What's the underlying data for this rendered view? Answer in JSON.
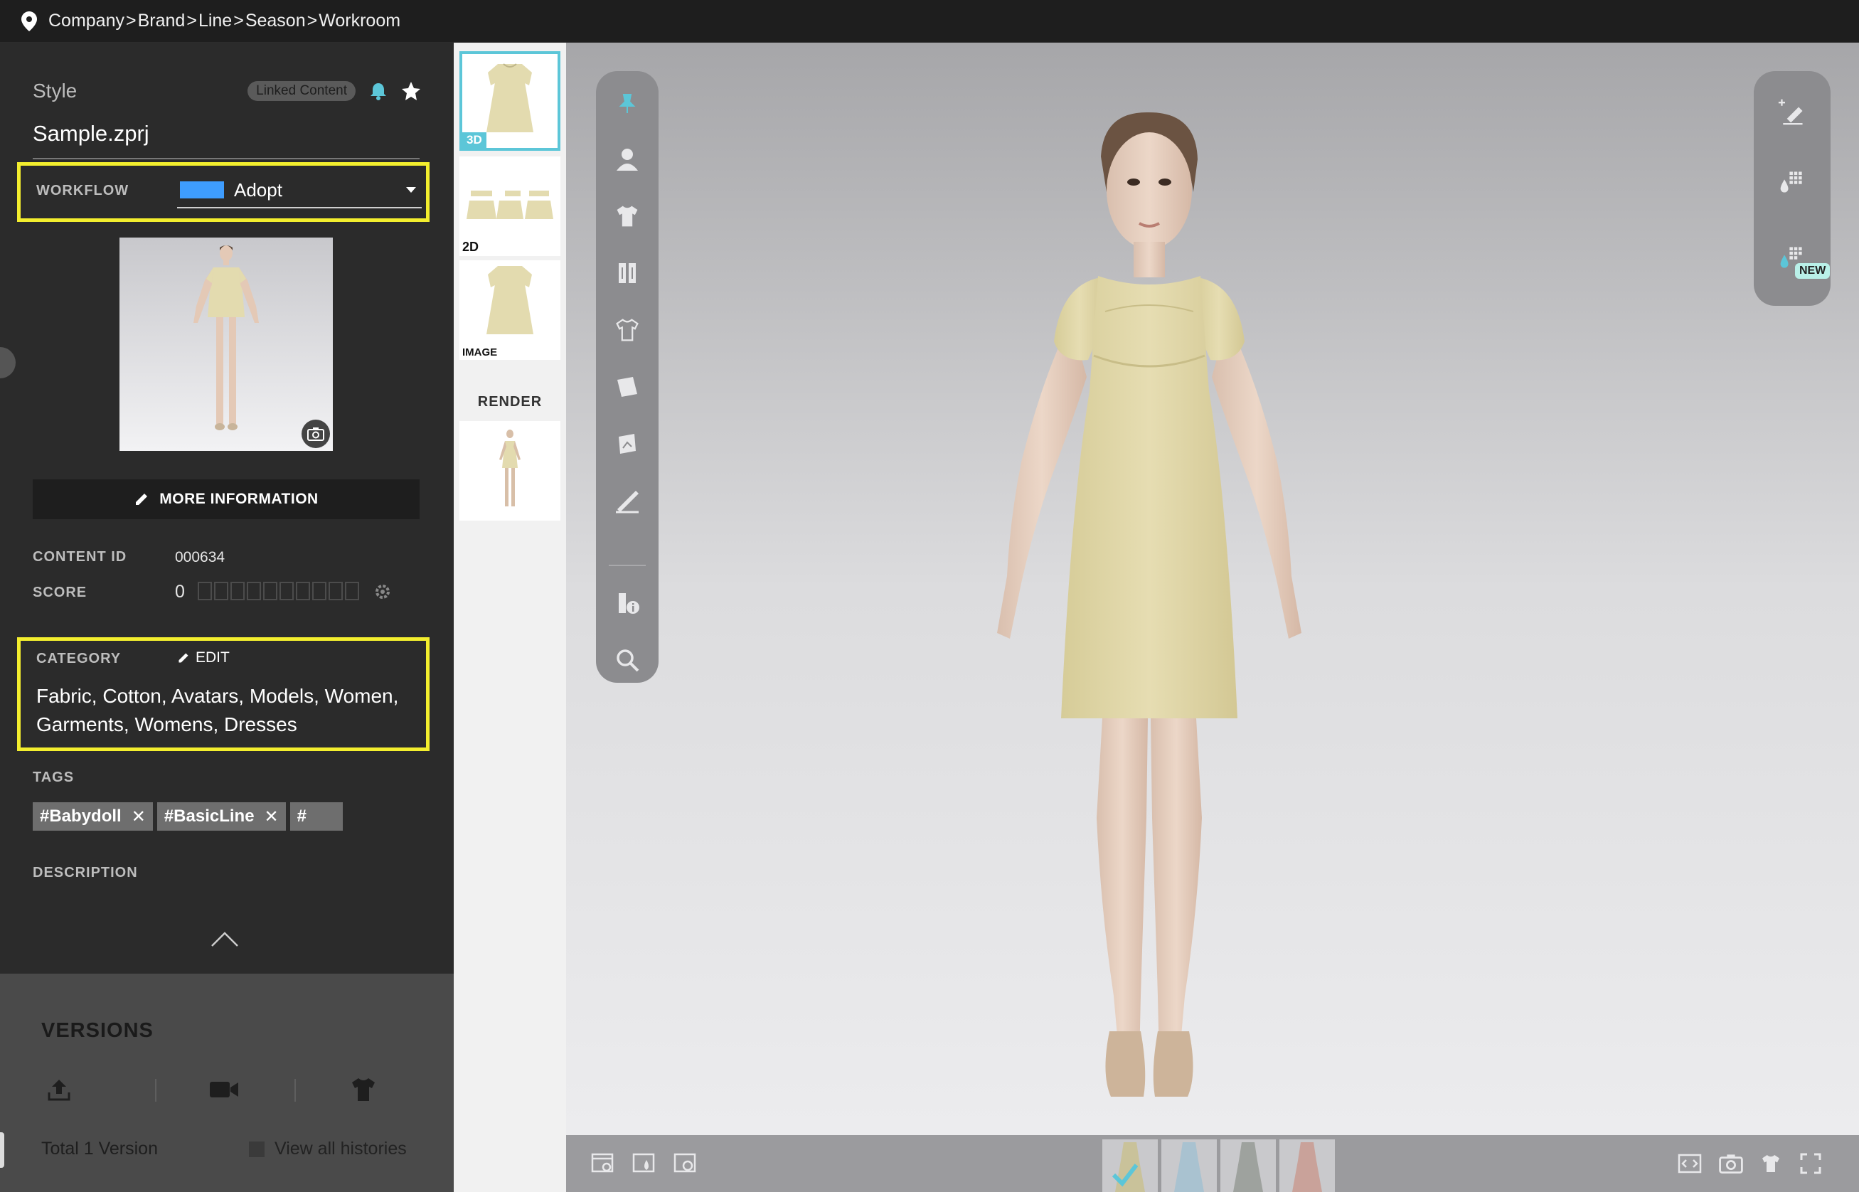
{
  "breadcrumb": {
    "items": [
      "Company",
      "Brand",
      "Line",
      "Season",
      "Workroom"
    ],
    "separator": ">"
  },
  "style": {
    "label": "Style",
    "linked_badge": "Linked Content",
    "filename": "Sample.zprj"
  },
  "workflow": {
    "label": "WORKFLOW",
    "value": "Adopt",
    "swatch_color": "#3e9dff"
  },
  "more_info_label": "MORE INFORMATION",
  "content_id": {
    "label": "CONTENT ID",
    "value": "000634"
  },
  "score": {
    "label": "SCORE",
    "value": "0",
    "max": 10
  },
  "category": {
    "label": "CATEGORY",
    "edit_label": "EDIT",
    "text": "Fabric, Cotton, Avatars, Models, Women, Garments, Womens, Dresses"
  },
  "tags": {
    "label": "TAGS",
    "items": [
      "#Babydoll",
      "#BasicLine"
    ],
    "input_placeholder": "#"
  },
  "description_label": "DESCRIPTION",
  "versions": {
    "title": "VERSIONS",
    "total": "Total 1 Version",
    "view_all": "View all histories"
  },
  "thumbnails": {
    "label_3d": "3D",
    "label_2d": "2D",
    "label_image": "IMAGE",
    "render_label": "RENDER"
  },
  "right_toolbar": {
    "new_badge": "NEW"
  },
  "colors": {
    "highlight": "#f3ee2e",
    "accent": "#5cc6d8",
    "dress": "#e3dbaf"
  },
  "colorways": [
    "#c9c29a",
    "#a9c2d0",
    "#9ea29e",
    "#c9a29a"
  ]
}
